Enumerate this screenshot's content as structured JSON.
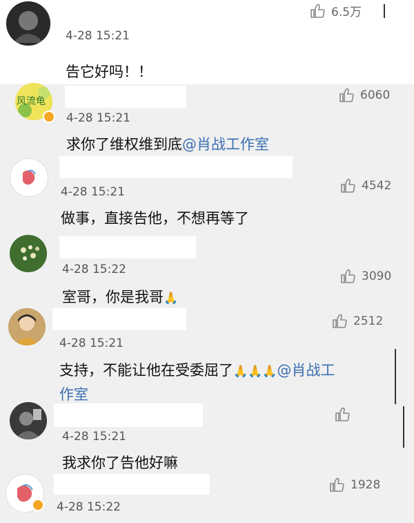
{
  "comments": [
    {
      "time": "4-28 15:21",
      "text": "告它好吗！！",
      "likes": "6.5万"
    },
    {
      "time": "4-28 15:21",
      "text": "求你了维权维到底",
      "mention": "@肖战工作室",
      "likes": "6060",
      "avatar_label": "风流龟"
    },
    {
      "time": "4-28 15:21",
      "text": "做事，直接告他，不想再等了",
      "likes": "4542"
    },
    {
      "time": "4-28 15:22",
      "text": "室哥，你是我哥",
      "emoji": "🙏",
      "likes": "3090"
    },
    {
      "time": "4-28 15:21",
      "text": "支持，不能让他在受委屈了",
      "emoji": "🙏🙏🙏",
      "mention": "@肖战工",
      "mention2": "作室",
      "likes": "2512"
    },
    {
      "time": "4-28 15:21",
      "text": "我求你了告他好嘛",
      "likes": ""
    },
    {
      "time": "4-28 15:22",
      "text": "",
      "likes": "1928"
    }
  ],
  "icons": {
    "like": "thumbs-up-icon",
    "verified": "verified-badge-icon"
  },
  "colors": {
    "background": "#f0f0f0",
    "mention": "#3a6fb3",
    "verified": "#f5a623"
  }
}
